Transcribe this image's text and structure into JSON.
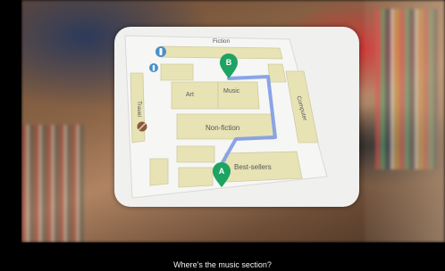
{
  "map": {
    "labels": {
      "fiction": "Fiction",
      "travel": "Travel",
      "art": "Art",
      "music": "Music",
      "computer": "Computer",
      "non_fiction": "Non-fiction",
      "best_sellers": "Best-sellers"
    },
    "markers": {
      "start": "A",
      "destination": "B"
    },
    "colors": {
      "route": "#7f9be6",
      "marker": "#1ea362",
      "shelf": "#e8e3b4",
      "floor": "#f5f5f4"
    },
    "icons": {
      "restroom": "restroom-icon",
      "no_entry": "no-entry-icon"
    }
  },
  "caption": {
    "text": "Where's the music section?"
  }
}
